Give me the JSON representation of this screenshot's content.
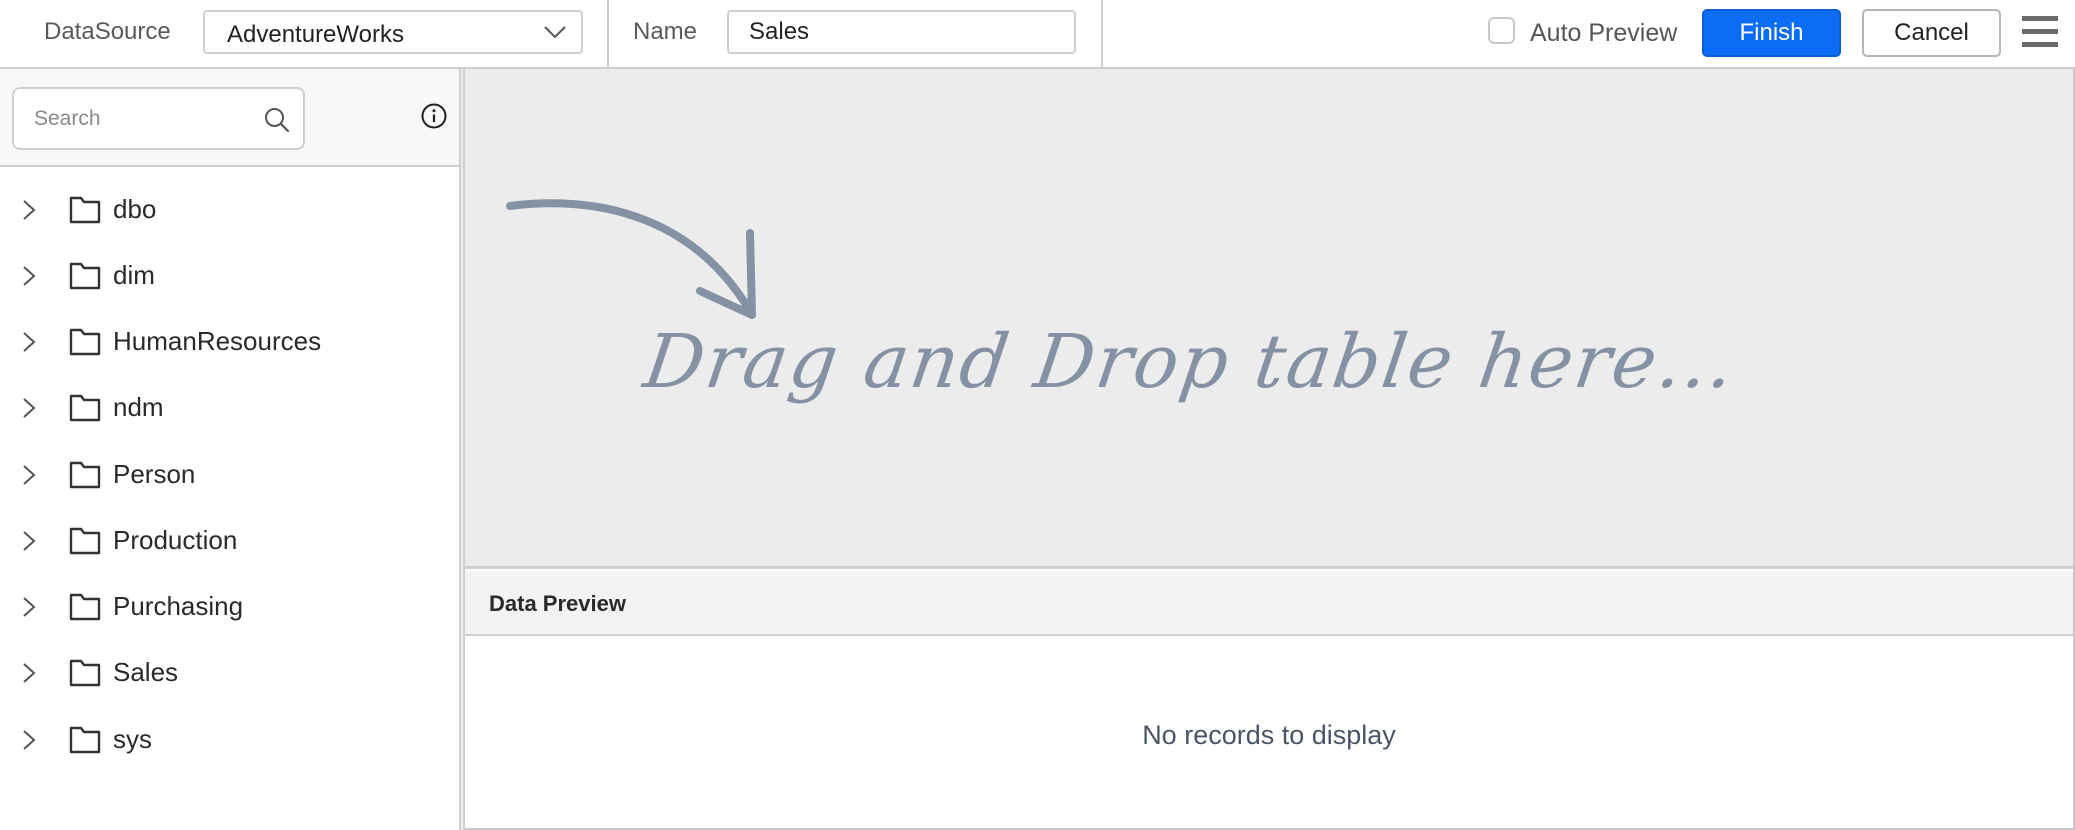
{
  "header": {
    "datasource_label": "DataSource",
    "datasource_value": "AdventureWorks",
    "name_label": "Name",
    "name_value": "Sales",
    "auto_preview_label": "Auto Preview",
    "auto_preview_checked": false,
    "finish_label": "Finish",
    "cancel_label": "Cancel",
    "accent_color": "#0b6cf5"
  },
  "left_panel": {
    "search_placeholder": "Search",
    "search_value": "",
    "tree": [
      {
        "label": "dbo",
        "icon": "folder-icon",
        "expanded": false
      },
      {
        "label": "dim",
        "icon": "folder-icon",
        "expanded": false
      },
      {
        "label": "HumanResources",
        "icon": "folder-icon",
        "expanded": false
      },
      {
        "label": "ndm",
        "icon": "folder-icon",
        "expanded": false
      },
      {
        "label": "Person",
        "icon": "folder-icon",
        "expanded": false
      },
      {
        "label": "Production",
        "icon": "folder-icon",
        "expanded": false
      },
      {
        "label": "Purchasing",
        "icon": "folder-icon",
        "expanded": false
      },
      {
        "label": "Sales",
        "icon": "folder-icon",
        "expanded": false
      },
      {
        "label": "sys",
        "icon": "folder-icon",
        "expanded": false
      }
    ]
  },
  "drop_area": {
    "hint_text": "Drag and Drop table here...",
    "hint_color": "#8592a3"
  },
  "data_preview": {
    "title": "Data Preview",
    "empty_message": "No records to display"
  }
}
